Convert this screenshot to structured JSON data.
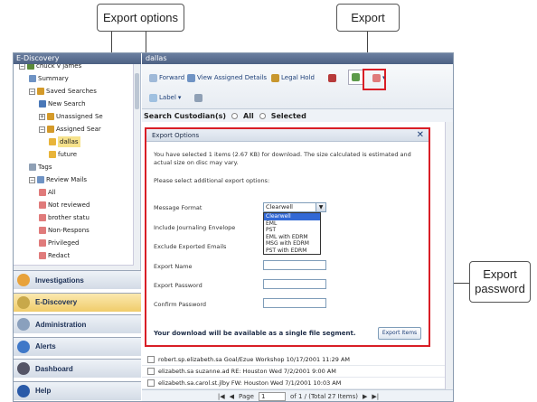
{
  "callouts": {
    "export_options": "Export options",
    "export": "Export",
    "export_password_line1": "Export",
    "export_password_line2": "password"
  },
  "left_panel": {
    "title": "E-Discovery",
    "tree": [
      {
        "label": "chuck v james",
        "level": 0
      },
      {
        "label": "Summary",
        "level": 1
      },
      {
        "label": "Saved Searches",
        "level": 1
      },
      {
        "label": "New Search",
        "level": 2
      },
      {
        "label": "Unassigned Se",
        "level": 2
      },
      {
        "label": "Assigned Sear",
        "level": 2
      },
      {
        "label": "dallas",
        "level": 3,
        "selected": true
      },
      {
        "label": "future",
        "level": 3
      },
      {
        "label": "Tags",
        "level": 1
      },
      {
        "label": "Review Mails",
        "level": 1
      },
      {
        "label": "All",
        "level": 2
      },
      {
        "label": "Not reviewed",
        "level": 2
      },
      {
        "label": "brother statu",
        "level": 2
      },
      {
        "label": "Non-Respons",
        "level": 2
      },
      {
        "label": "Privileged",
        "level": 2
      },
      {
        "label": "Redact",
        "level": 2
      }
    ],
    "nav": [
      {
        "label": "Investigations",
        "icon": "investigations-icon",
        "color": "#e8a23a"
      },
      {
        "label": "E-Discovery",
        "icon": "scales-icon",
        "color": "#c8a84a"
      },
      {
        "label": "Administration",
        "icon": "admin-icon",
        "color": "#8aa0bd"
      },
      {
        "label": "Alerts",
        "icon": "alerts-icon",
        "color": "#3f78c8"
      },
      {
        "label": "Dashboard",
        "icon": "dashboard-icon",
        "color": "#556"
      },
      {
        "label": "Help",
        "icon": "help-icon",
        "color": "#2a5aa8"
      }
    ]
  },
  "main": {
    "title": "dallas",
    "toolbar": {
      "forward": "Forward",
      "view_assigned": "View Assigned Details",
      "legal_hold": "Legal Hold",
      "label": "Label"
    },
    "custodian": {
      "label": "Search Custodian(s)",
      "all": "All",
      "selected": "Selected"
    },
    "rows": [
      "robert.sp.elizabeth.sa Goal/Ezue Workshop 10/17/2001 11:29 AM",
      "elizabeth.sa suzanne.ad RE: Houston Wed 7/2/2001 9:00 AM",
      "elizabeth.sa.carol.st.jlby FW: Houston Wed 7/1/2001 10:03 AM"
    ],
    "pager": {
      "page_label": "Page",
      "page_value": "1",
      "total": "of 1 / (Total 27 Items)"
    }
  },
  "dialog": {
    "title": "Export Options",
    "message": "You have selected 1 items (2.67 KB) for download. The size calculated is estimated and actual size on disc may vary.",
    "prompt": "Please select additional export options:",
    "fields": {
      "message_format": "Message Format",
      "include_journaling": "Include Journaling Envelope",
      "exclude_exported": "Exclude Exported Emails",
      "export_name": "Export Name",
      "export_password": "Export Password",
      "confirm_password": "Confirm Password"
    },
    "format_selected": "Clearwell",
    "format_options": [
      "Clearwell",
      "EML",
      "PST",
      "EML with EDRM",
      "MSG with EDRM",
      "PST with EDRM"
    ],
    "footer": "Your download will be available as a single file segment.",
    "export_button": "Export Items"
  },
  "colors": {
    "highlight_red": "#d91e26",
    "title_bar": "#4d6183",
    "selection_blue": "#3168d5"
  }
}
